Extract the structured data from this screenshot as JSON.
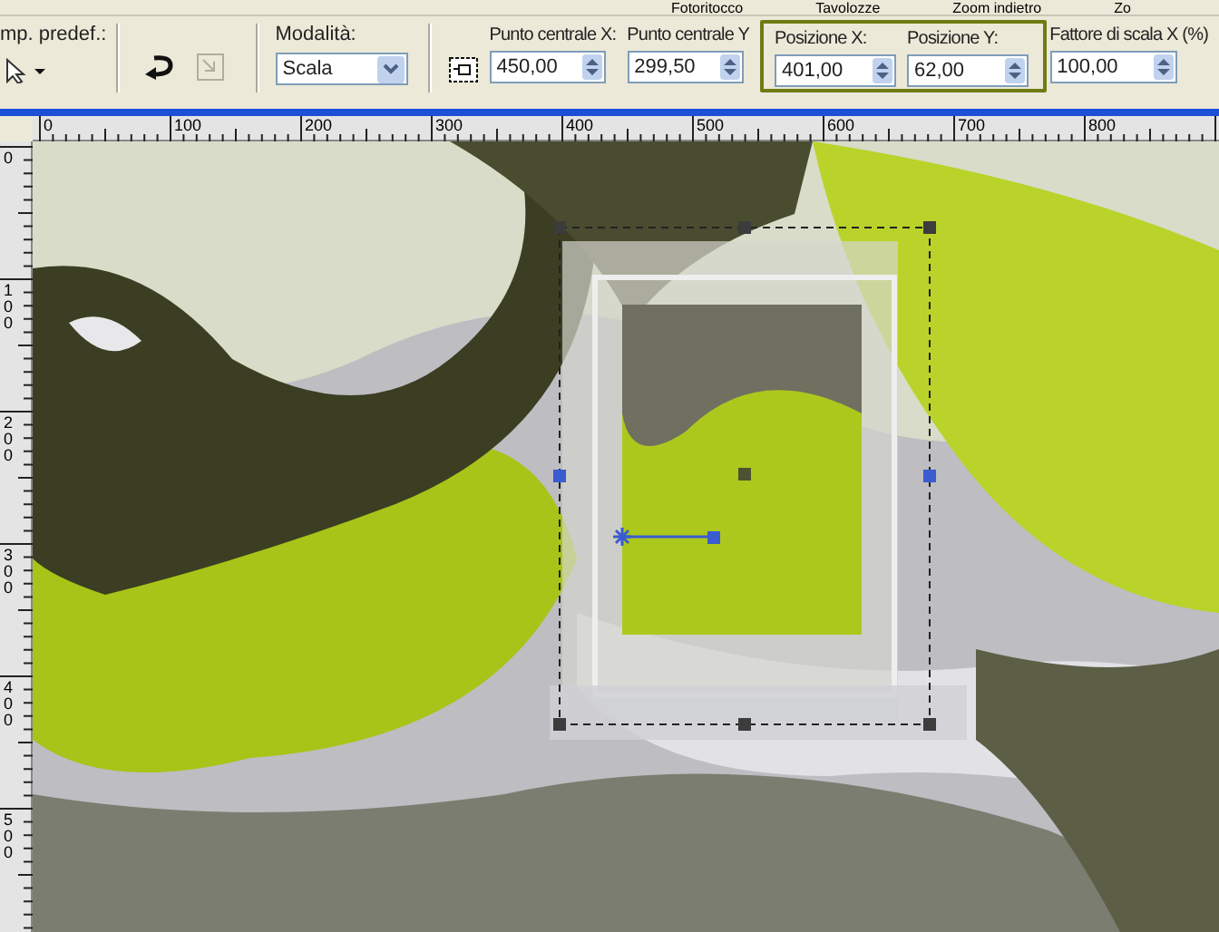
{
  "menu_strip": [
    {
      "label": "Fotoritocco"
    },
    {
      "label": "Tavolozze"
    },
    {
      "label": "Zoom indietro"
    },
    {
      "label": "Zo"
    }
  ],
  "toolbar": {
    "preset_label": "mp. predef.:",
    "mode_label": "Modalità:",
    "mode_value": "Scala",
    "center_fields": [
      {
        "label": "Punto centrale X:",
        "value": "450,00"
      },
      {
        "label": "Punto centrale Y",
        "value": "299,50"
      }
    ],
    "position_group": {
      "highlighted": true,
      "fields": [
        {
          "label": "Posizione X:",
          "value": "401,00"
        },
        {
          "label": "Posizione Y:",
          "value": "62,00"
        }
      ]
    },
    "scale_field": {
      "label": "Fattore di scala X (%)",
      "value": "100,00"
    }
  },
  "ruler": {
    "x_labels": [
      "0",
      "100",
      "200",
      "300",
      "400",
      "500",
      "600",
      "700",
      "800"
    ],
    "y_labels": [
      "0",
      "100",
      "200",
      "300",
      "400",
      "500"
    ]
  }
}
